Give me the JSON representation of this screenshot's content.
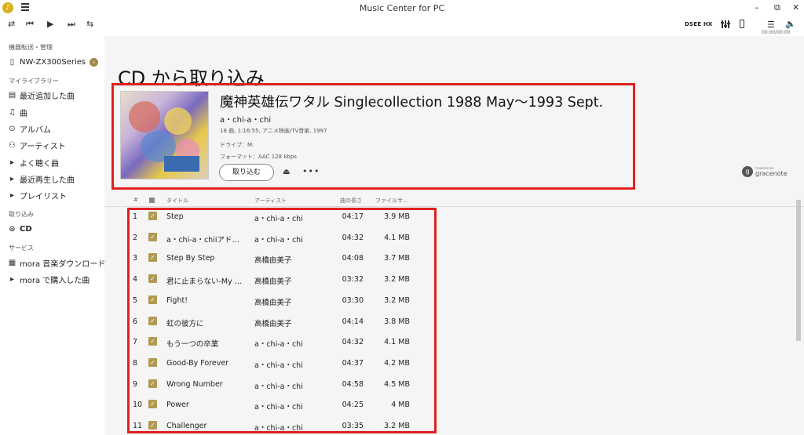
{
  "app": {
    "title": "Music Center for PC",
    "window_controls": {
      "minimize": "–",
      "restore": "⧉",
      "close": "✕"
    }
  },
  "player": {
    "repeat_icon": "⇄",
    "prev_icon": "⏮",
    "play_icon": "▶",
    "next_icon": "⏭",
    "shuffle_icon": "⇆",
    "dsee_label": "DSEE HX",
    "time": "00:00/00:00",
    "list_icon": "☰",
    "volume_icon": "🔈"
  },
  "sidebar": {
    "device_section": "機器転送・管理",
    "device_name": "NW-ZX300Series",
    "library_section": "マイライブラリー",
    "library_items": [
      {
        "label": "最近追加した曲",
        "icon": "▤"
      },
      {
        "label": "曲",
        "icon": "♫"
      },
      {
        "label": "アルバム",
        "icon": "⊙"
      },
      {
        "label": "アーティスト",
        "icon": "⚇"
      },
      {
        "label": "よく聴く曲",
        "icon": "▸"
      },
      {
        "label": "最近再生した曲",
        "icon": "▸"
      },
      {
        "label": "プレイリスト",
        "icon": "▸"
      }
    ],
    "import_section": "取り込み",
    "cd_label": "CD",
    "service_section": "サービス",
    "service_items": [
      {
        "label": "mora 音楽ダウンロード",
        "icon": "▦"
      },
      {
        "label": "mora で購入した曲",
        "icon": "▸"
      }
    ]
  },
  "main": {
    "page_title": "CD から取り込み",
    "album": {
      "title": "魔神英雄伝ワタル Singlecollection 1988 May～1993 Sept.",
      "artist": "a・chi-a・chi",
      "meta": "18 曲, 1:16:55, アニメ映画/TV音楽, 1997",
      "drive": "ドライブ：M:",
      "format": "フォーマット：AAC 128 kbps",
      "import_button": "取り込む",
      "more": "•••",
      "eject_icon": "⏏"
    },
    "gracenote": {
      "powered": "POWERED BY",
      "name": "gracenote"
    },
    "table": {
      "headers": {
        "num": "#",
        "title": "タイトル",
        "artist": "アーティスト",
        "length": "曲の長さ",
        "size": "ファイルサ…"
      },
      "rows": [
        {
          "num": "1",
          "title": "Step",
          "artist": "a・chi-a・chi",
          "length": "04:17",
          "size": "3.9 MB"
        },
        {
          "num": "2",
          "title": "a・chi-a・chiiアド…",
          "artist": "a・chi-a・chi",
          "length": "04:32",
          "size": "4.1 MB"
        },
        {
          "num": "3",
          "title": "Step By Step",
          "artist": "高橋由美子",
          "length": "04:08",
          "size": "3.7 MB"
        },
        {
          "num": "4",
          "title": "君に止まらない-My …",
          "artist": "高橋由美子",
          "length": "03:32",
          "size": "3.2 MB"
        },
        {
          "num": "5",
          "title": "Fight!",
          "artist": "高橋由美子",
          "length": "03:30",
          "size": "3.2 MB"
        },
        {
          "num": "6",
          "title": "虹の彼方に",
          "artist": "高橋由美子",
          "length": "04:14",
          "size": "3.8 MB"
        },
        {
          "num": "7",
          "title": "もう一つの卒業",
          "artist": "a・chi-a・chi",
          "length": "04:32",
          "size": "4.1 MB"
        },
        {
          "num": "8",
          "title": "Good-By Forever",
          "artist": "a・chi-a・chi",
          "length": "04:37",
          "size": "4.2 MB"
        },
        {
          "num": "9",
          "title": "Wrong Number",
          "artist": "a・chi-a・chi",
          "length": "04:58",
          "size": "4.5 MB"
        },
        {
          "num": "10",
          "title": "Power",
          "artist": "a・chi-a・chi",
          "length": "04:25",
          "size": "4 MB"
        },
        {
          "num": "11",
          "title": "Challenger",
          "artist": "a・chi-a・chi",
          "length": "03:35",
          "size": "3.2 MB"
        }
      ]
    }
  },
  "colors": {
    "highlight": "#e02020",
    "accent": "#b09a52"
  }
}
